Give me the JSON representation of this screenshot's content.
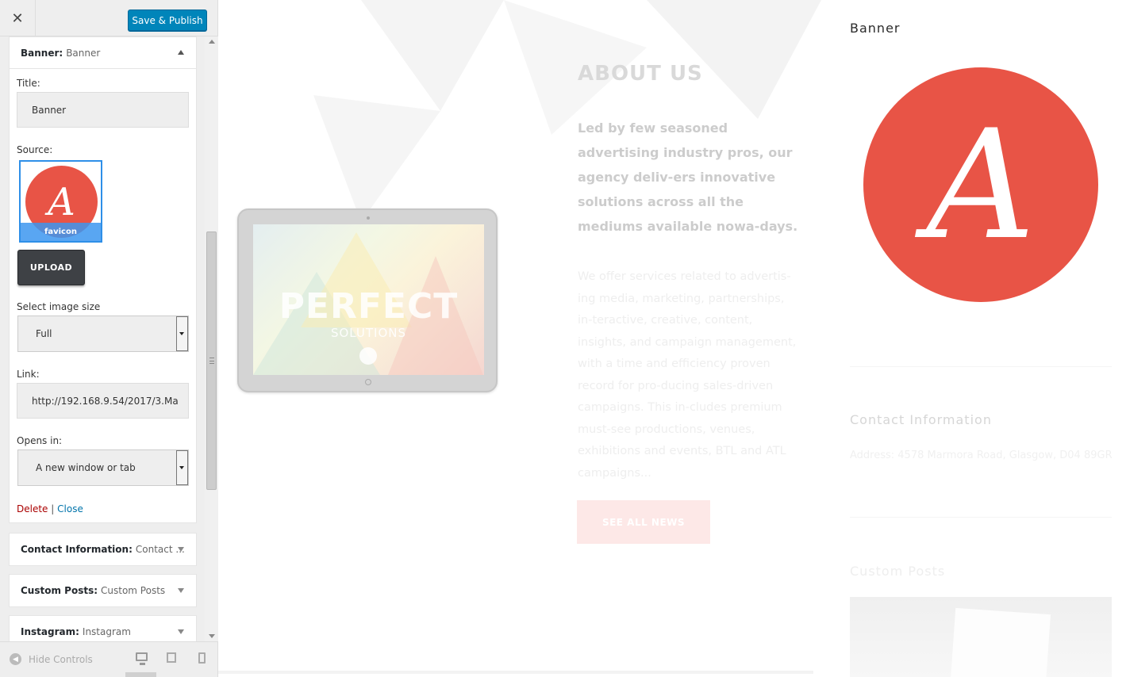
{
  "panel": {
    "close_icon": "close-icon",
    "publish_label": "Save & Publish",
    "banner_widget": {
      "name": "Banner:",
      "subtitle": "Banner",
      "title_label": "Title:",
      "title_value": "Banner",
      "source_label": "Source:",
      "thumb_letter": "A",
      "thumb_caption": "favicon",
      "upload_label": "UPLOAD",
      "size_label": "Select image size",
      "size_value": "Full",
      "link_label": "Link:",
      "link_value": "http://192.168.9.54/2017/3.Ma",
      "opens_label": "Opens in:",
      "opens_value": "A new window or tab",
      "delete_label": "Delete",
      "separator": "|",
      "close_label": "Close"
    },
    "widgets": [
      {
        "name": "Contact Information:",
        "subtitle": "Contact ..."
      },
      {
        "name": "Custom Posts:",
        "subtitle": "Custom Posts"
      },
      {
        "name": "Instagram:",
        "subtitle": "Instagram"
      }
    ],
    "footer": {
      "hide_label": "Hide Controls"
    }
  },
  "preview": {
    "tablet_title": "PERFECT",
    "tablet_subtitle": "SOLUTIONS",
    "about_title": "ABOUT US",
    "about_lead": "Led by few seasoned advertising industry pros, our agency deliv-ers innovative solutions across all the mediums available nowa-days.",
    "about_body": "We offer services related to advertis-ing media, marketing, partnerships, in-teractive, creative, content, insights, and campaign management, with a time and efficiency proven record for pro-ducing sales-driven campaigns. This in-cludes premium must-see productions, venues, exhibitions and events, BTL and ATL campaigns...",
    "news_button": "SEE ALL NEWS",
    "sidebar": {
      "banner_title": "Banner",
      "logo_letter": "A",
      "contact_title": "Contact Information",
      "contact_address": "Address: 4578 Marmora Road, Glasgow, D04 89GR",
      "posts_title": "Custom Posts"
    }
  },
  "colors": {
    "publish_blue": "#0085ba",
    "logo_red": "#e85446",
    "delete_red": "#aa0000",
    "link_blue": "#0073aa"
  }
}
